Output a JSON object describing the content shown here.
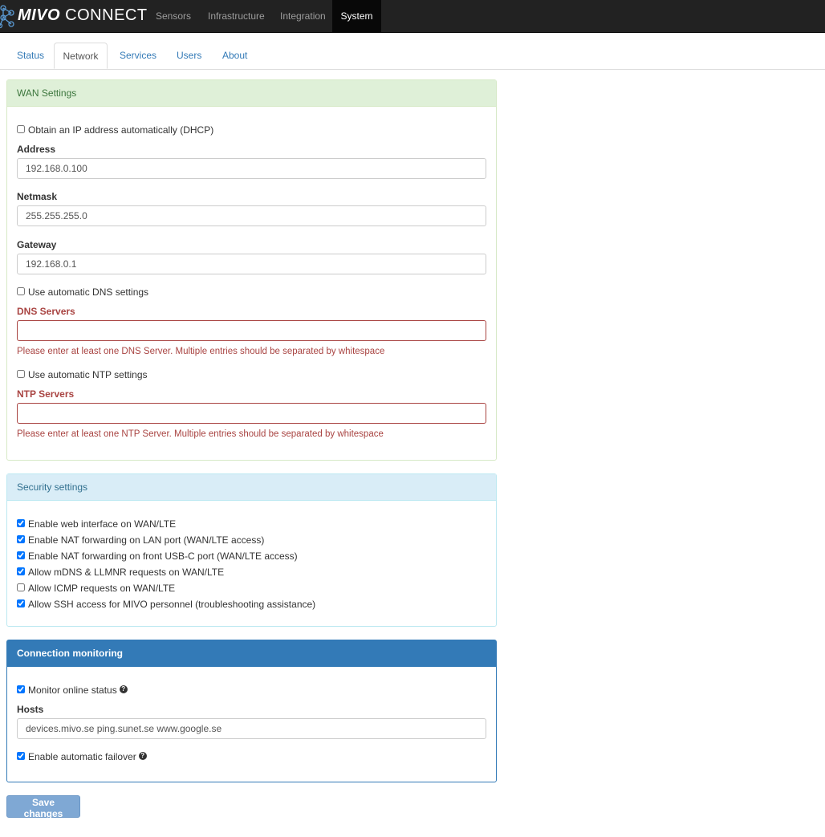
{
  "brand": {
    "bold": "MIVO",
    "rest": " CONNECT"
  },
  "nav": [
    "Sensors",
    "Infrastructure",
    "Integration",
    "System"
  ],
  "tabs": [
    "Status",
    "Network",
    "Services",
    "Users",
    "About"
  ],
  "wan": {
    "title": "WAN Settings",
    "dhcp_label": "Obtain an IP address automatically (DHCP)",
    "dhcp_checked": false,
    "address_label": "Address",
    "address_value": "192.168.0.100",
    "netmask_label": "Netmask",
    "netmask_value": "255.255.255.0",
    "gateway_label": "Gateway",
    "gateway_value": "192.168.0.1",
    "auto_dns_label": "Use automatic DNS settings",
    "auto_dns_checked": false,
    "dns_label": "DNS Servers",
    "dns_value": "",
    "dns_error": "Please enter at least one DNS Server. Multiple entries should be separated by whitespace",
    "auto_ntp_label": "Use automatic NTP settings",
    "auto_ntp_checked": false,
    "ntp_label": "NTP Servers",
    "ntp_value": "",
    "ntp_error": "Please enter at least one NTP Server. Multiple entries should be separated by whitespace"
  },
  "security": {
    "title": "Security settings",
    "items": [
      {
        "label": "Enable web interface on WAN/LTE",
        "checked": true
      },
      {
        "label": "Enable NAT forwarding on LAN port (WAN/LTE access)",
        "checked": true
      },
      {
        "label": "Enable NAT forwarding on front USB-C port (WAN/LTE access)",
        "checked": true
      },
      {
        "label": "Allow mDNS & LLMNR requests on WAN/LTE",
        "checked": true
      },
      {
        "label": "Allow ICMP requests on WAN/LTE",
        "checked": false
      },
      {
        "label": "Allow SSH access for MIVO personnel (troubleshooting assistance)",
        "checked": true
      }
    ]
  },
  "monitoring": {
    "title": "Connection monitoring",
    "monitor_label": "Monitor online status",
    "monitor_checked": true,
    "hosts_label": "Hosts",
    "hosts_value": "devices.mivo.se ping.sunet.se www.google.se",
    "failover_label": "Enable automatic failover",
    "failover_checked": true,
    "help_glyph": "?"
  },
  "save_label": "Save changes",
  "colors": {
    "navbar": "#222222",
    "link": "#337ab7",
    "error": "#a94442",
    "primary": "#337ab7"
  }
}
